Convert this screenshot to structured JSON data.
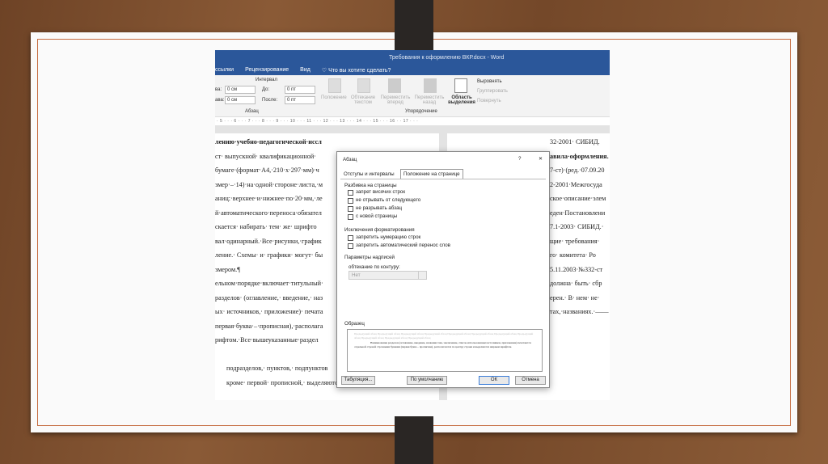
{
  "word": {
    "title": "Требования к оформлению ВКР.docx - Word",
    "tabs": [
      "ссылки",
      "Рецензирование",
      "Вид",
      "Что вы хотите сделать?"
    ],
    "ribbon": {
      "interval_label": "Интервал",
      "left_label": "ва:",
      "right_label": "ава:",
      "left_val": "0 см",
      "right_val": "0 см",
      "before_label": "До:",
      "after_label": "После:",
      "before_val": "0 пт",
      "after_val": "0 пт",
      "paragraph_group": "Абзац",
      "position": "Положение",
      "wrap": "Обтекание текстом",
      "forward": "Переместить вперед",
      "backward": "Переместить назад",
      "selection_pane": "Область выделения",
      "align": "Выровнять",
      "group": "Группировать",
      "rotate": "Повернуть",
      "arrange_group": "Упорядочение"
    },
    "ruler": "· 5 · · · 6 · · · 7 · · · 8 · · · 9 · · · 10 · · · 11 · · · 12 · · · 13 · · · 14 · · · 15 · · · 16 · · 17 · · ·",
    "left_page": [
      "лению·учебно-педагогической·иссл",
      "ст·  выпускной·  квалификационной·",
      "бумаге·(формат·А4,·210·х·297·мм)·ч",
      "змер·–·14)·на·одной·стороне·листа,·м",
      "аниц:·верхнее·и·нижнее·по·20·мм,·ле",
      "й·автоматического·переноса·обязател",
      "скается·  набирать·  тем·  же·  шрифто",
      "вал·одинарный.·Все·рисунки,·график",
      "ление.·  Схемы·  и·  графики·  могут·  бы",
      "змером.¶",
      "ельном·порядке·включает·титульный·",
      "разделов·  (оглавление,·  введение,·  наз",
      "ых·  источников,·  приложение)·  печата",
      "первая·буква·–·прописная),·располага",
      "рифтом.·Все·вышеуказанные·раздел",
      "",
      "подразделов,·  пунктов,·  подпунктов",
      "кроме·  первой·  прописной,·  выделяются·  жирным·  шрифтом·  и·"
    ],
    "right_page": [
      "32-2001·  СИБИД.",
      "авила·оформления.",
      "7-ст)·(ред.·07.09.20",
      "2-2001·Межгосуда",
      "ское·описание·элем",
      "еден·Постановлени",
      "7.1-2003·  СИБИД.·",
      "щие·  требования·",
      "го·  комитета·  Ро",
      "5.11.2003·№332-ст",
      "должна·  быть·  сбр",
      "ерен.·  В·  нем·  не·",
      "тах,·названиях.·——"
    ]
  },
  "dialog": {
    "title": "Абзац",
    "help": "?",
    "close": "✕",
    "tabs": [
      "Отступы и интервалы",
      "Положение на странице"
    ],
    "pagination_label": "Разбивка на страницы",
    "pagination": [
      "запрет висячих строк",
      "не отрывать от следующего",
      "не разрывать абзац",
      "с новой страницы"
    ],
    "exceptions_label": "Исключения форматирования",
    "exceptions": [
      "запретить нумерацию строк",
      "запретить автоматический перенос слов"
    ],
    "textbox_label": "Параметры надписей",
    "wrap_label": "обтекание по контуру:",
    "wrap_value": "Нет",
    "sample_label": "Образец",
    "sample_prev": "Предыдущий абзац Предыдущий абзац Предыдущий абзац Предыдущий абзац Предыдущий абзац Предыдущий абзац Предыдущий абзац Предыдущий абзац Предыдущий абзац Предыдущий абзац Предыдущий абзац",
    "sample_text": "Наименование разделов (оглавление, введение, названия глав, заключение, список использованных источников, приложение) печатаются отдельной строкой строчными буквами (первая буква – прописная), располагаются по центру строки и выделяются жирным шрифтом.",
    "tabs_button": "Табуляция...",
    "default_button": "По умолчанию",
    "ok": "ОК",
    "cancel": "Отмена"
  }
}
